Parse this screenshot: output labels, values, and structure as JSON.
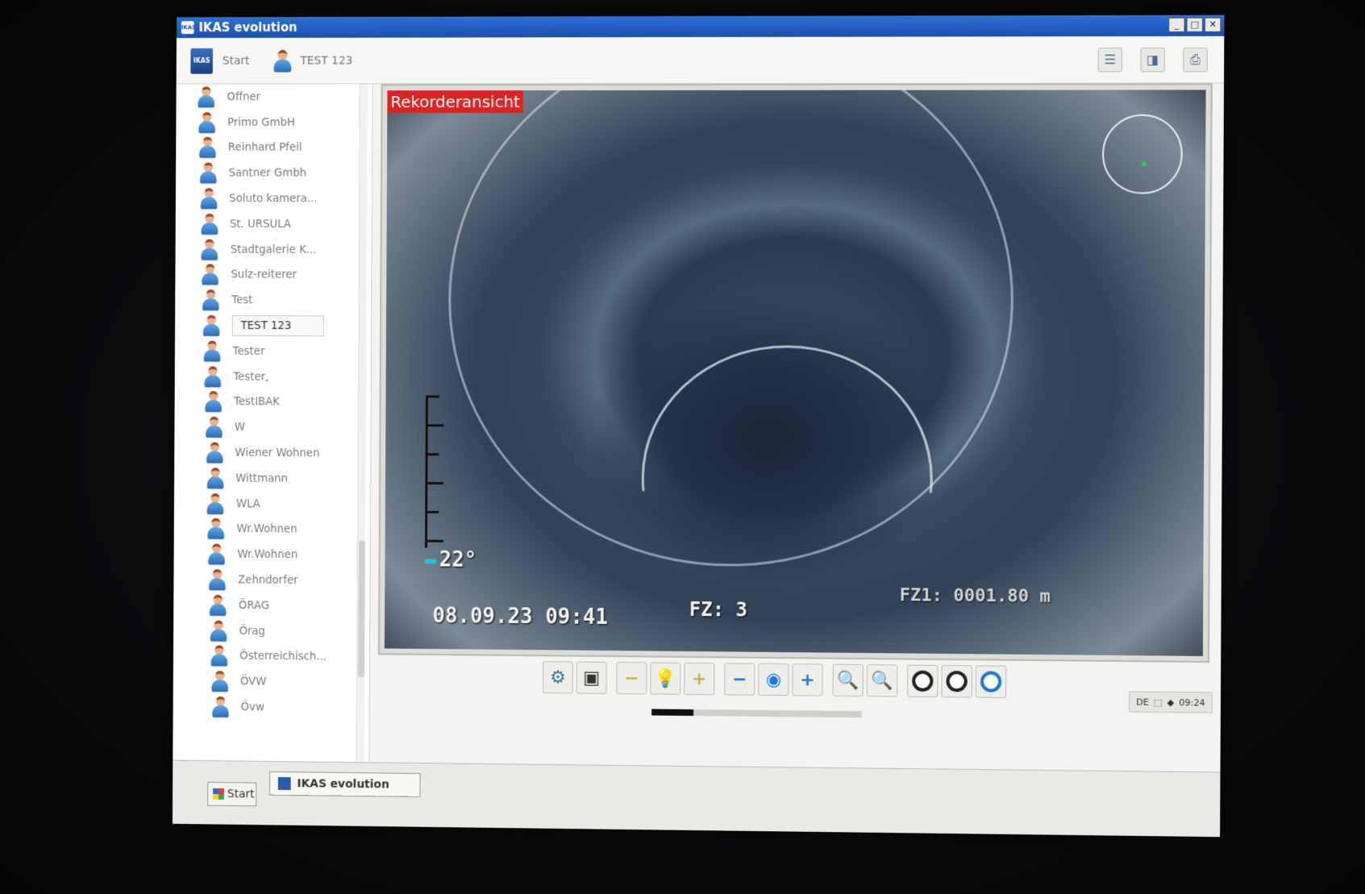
{
  "window": {
    "title": "IKAS evolution",
    "controls": [
      "_",
      "□",
      "✕"
    ]
  },
  "toolbar": {
    "start_label": "Start",
    "logo_text": "IKAS",
    "project_label": "TEST 123",
    "right_buttons": [
      "report-icon",
      "camera-box-icon",
      "printer-icon"
    ]
  },
  "sidebar": {
    "items": [
      {
        "label": "Offner",
        "has_arrow": true
      },
      {
        "label": "Primo GmbH",
        "has_arrow": true
      },
      {
        "label": "Reinhard Pfeil",
        "has_arrow": true
      },
      {
        "label": "Santner Gmbh",
        "has_arrow": true
      },
      {
        "label": "Soluto kamera...",
        "has_arrow": true
      },
      {
        "label": "St. URSULA",
        "has_arrow": false
      },
      {
        "label": "Stadtgalerie K...",
        "has_arrow": false
      },
      {
        "label": "Sulz-reiterer",
        "has_arrow": true
      },
      {
        "label": "Test",
        "has_arrow": false
      },
      {
        "label": "TEST 123",
        "has_arrow": false,
        "selected": true
      },
      {
        "label": "Tester",
        "has_arrow": true
      },
      {
        "label": "Tester,",
        "has_arrow": true
      },
      {
        "label": "TestIBAK",
        "has_arrow": true
      },
      {
        "label": "W",
        "has_arrow": false
      },
      {
        "label": "Wiener Wohnen",
        "has_arrow": true
      },
      {
        "label": "Wittmann",
        "has_arrow": true
      },
      {
        "label": "WLA",
        "has_arrow": true
      },
      {
        "label": "Wr.Wohnen",
        "has_arrow": true
      },
      {
        "label": "Wr.Wohnen",
        "has_arrow": true
      },
      {
        "label": "Zehndorfer",
        "has_arrow": true
      },
      {
        "label": "ÖRAG",
        "has_arrow": true
      },
      {
        "label": "Örag",
        "has_arrow": true
      },
      {
        "label": "Österreichisch...",
        "has_arrow": true
      },
      {
        "label": "ÖVW",
        "has_arrow": false
      },
      {
        "label": "Övw",
        "has_arrow": true
      }
    ]
  },
  "video": {
    "overlay_label": "Rekorderansicht",
    "angle": "22°",
    "datetime": "08.09.23  09:41",
    "fz": "FZ: 3",
    "distance": "FZ1: 0001.80 m"
  },
  "controls": [
    {
      "name": "pipe-camera-icon",
      "glyph": "⚙",
      "color": "#3c6ea8"
    },
    {
      "name": "snapshot-icon",
      "glyph": "▣",
      "color": "#333"
    },
    {
      "name": "light-minus-icon",
      "glyph": "−",
      "color": "#c7b24a"
    },
    {
      "name": "light-bulb-icon",
      "glyph": "💡",
      "color": "#e0a21a"
    },
    {
      "name": "light-plus-icon",
      "glyph": "+",
      "color": "#c7b24a"
    },
    {
      "name": "focus-minus-icon",
      "glyph": "−",
      "color": "#1e78d6"
    },
    {
      "name": "aperture-icon",
      "glyph": "◉",
      "color": "#1e78d6"
    },
    {
      "name": "focus-plus-icon",
      "glyph": "+",
      "color": "#1e78d6"
    },
    {
      "name": "zoom-out-icon",
      "glyph": "🔍",
      "color": "#d33"
    },
    {
      "name": "zoom-in-icon",
      "glyph": "🔍",
      "color": "#2a2"
    },
    {
      "name": "rotate-left-icon",
      "glyph": "",
      "color": "#222"
    },
    {
      "name": "rotate-right-icon",
      "glyph": "",
      "color": "#222"
    },
    {
      "name": "rotate-reset-icon",
      "glyph": "",
      "color": "#1e78d6"
    }
  ],
  "progress": {
    "fraction": 0.2
  },
  "tray": {
    "lang": "DE",
    "time": "09:24"
  },
  "taskbar": {
    "start_label": "Start",
    "app_label": "IKAS evolution"
  },
  "colors": {
    "titlebar": "#2f6fd6",
    "recorder_label_bg": "#dd2222",
    "compass_dot": "#2bd24a"
  }
}
